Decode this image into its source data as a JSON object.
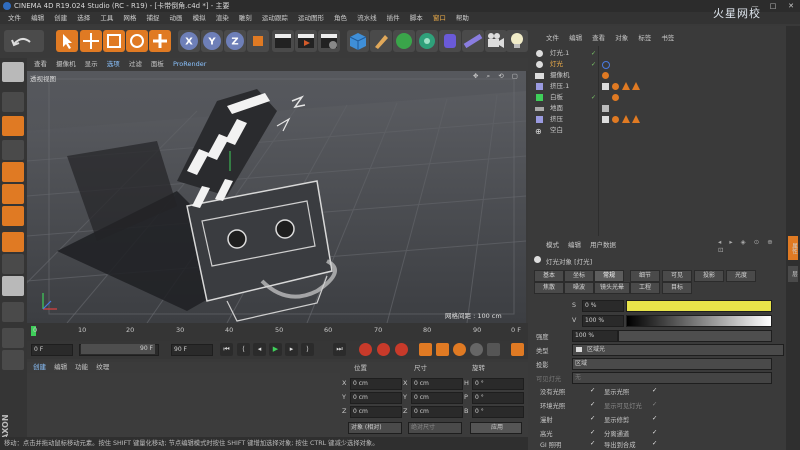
{
  "window": {
    "title": "CINEMA 4D R19.024 Studio (RC - R19) - [卡带倒角.c4d *] - 主要"
  },
  "menubar": {
    "items": [
      "文件",
      "编辑",
      "创建",
      "选择",
      "工具",
      "网格",
      "捕捉",
      "动画",
      "模拟",
      "渲染",
      "雕刻",
      "运动跟踪",
      "运动图形",
      "角色",
      "流水线",
      "插件",
      "脚本",
      "窗口",
      "帮助"
    ],
    "watermark": "火星网校"
  },
  "viewport": {
    "menu": [
      "查看",
      "摄像机",
      "显示",
      "选项",
      "过滤",
      "面板",
      "ProRender"
    ],
    "camera_label": "透视视图",
    "grid_label": "网格间距 : 100 cm"
  },
  "timeline": {
    "ticks": [
      "0",
      "10",
      "20",
      "30",
      "40",
      "50",
      "60",
      "70",
      "80",
      "90"
    ],
    "end_label": "0 F"
  },
  "transport": {
    "current": "0 F",
    "start": "0 F",
    "end": "90 F",
    "end2": "90 F"
  },
  "materials": {
    "menu": [
      "创建",
      "编辑",
      "功能",
      "纹理"
    ]
  },
  "coordinates": {
    "headers": [
      "位置",
      "尺寸",
      "旋转"
    ],
    "rows": [
      {
        "axis": "X",
        "pos": "0 cm",
        "size": "0 cm",
        "rlabel": "H",
        "rot": "0 °"
      },
      {
        "axis": "Y",
        "pos": "0 cm",
        "size": "0 cm",
        "rlabel": "P",
        "rot": "0 °"
      },
      {
        "axis": "Z",
        "pos": "0 cm",
        "size": "0 cm",
        "rlabel": "B",
        "rot": "0 °"
      }
    ],
    "mode": "对象 (相对)",
    "size_mode": "绝对尺寸",
    "apply": "应用"
  },
  "status": {
    "text": "移动：点击并拖动鼠标移动元素。按住 SHIFT 键量化移动; 节点编辑模式时按住 SHIFT 键增加选择对象; 按住 CTRL 键减少选择对象。"
  },
  "object_manager": {
    "menu": [
      "文件",
      "编辑",
      "查看",
      "对象",
      "标签",
      "书签"
    ],
    "objects": [
      {
        "name": "灯光.1",
        "color": "#e0e0e0",
        "sel": false
      },
      {
        "name": "灯光",
        "color": "#f3b04a",
        "sel": true
      },
      {
        "name": "摄像机",
        "color": "#e0e0e0",
        "sel": false
      },
      {
        "name": "挤压.1",
        "color": "#e0e0e0",
        "sel": false
      },
      {
        "name": "白板",
        "color": "#e0e0e0",
        "sel": false
      },
      {
        "name": "地面",
        "color": "#e0e0e0",
        "sel": false
      },
      {
        "name": "挤压",
        "color": "#e0e0e0",
        "sel": false
      },
      {
        "name": "空白",
        "color": "#e0e0e0",
        "sel": false
      }
    ]
  },
  "attributes": {
    "menu": [
      "模式",
      "编辑",
      "用户数据"
    ],
    "object_title": "灯光对象 [灯光]",
    "tabs_row1": [
      "基本",
      "坐标",
      "常规",
      "细节",
      "可见",
      "投影",
      "光度"
    ],
    "tabs_row2": [
      "焦散",
      "噪波",
      "镜头光晕",
      "工程",
      "目标"
    ],
    "selected_tab": "常规",
    "s_label": "S",
    "s_value": "0 %",
    "v_label": "V",
    "v_value": "100 %",
    "intensity_label": "强度",
    "intensity_value": "100 %",
    "type_label": "类型",
    "type_value": "区域光",
    "shadow_label": "投影",
    "shadow_value": "区域",
    "visible_label": "可见灯光",
    "visible_value": "无",
    "checks_left": [
      "没有光照",
      "环境光照",
      "漫射",
      "高光",
      "GI 照明"
    ],
    "checks_right": [
      "显示光照",
      "显示可见灯光",
      "显示修剪",
      "分离通道",
      "导出到合成"
    ]
  },
  "right_tabs": [
    "属性",
    "层"
  ]
}
